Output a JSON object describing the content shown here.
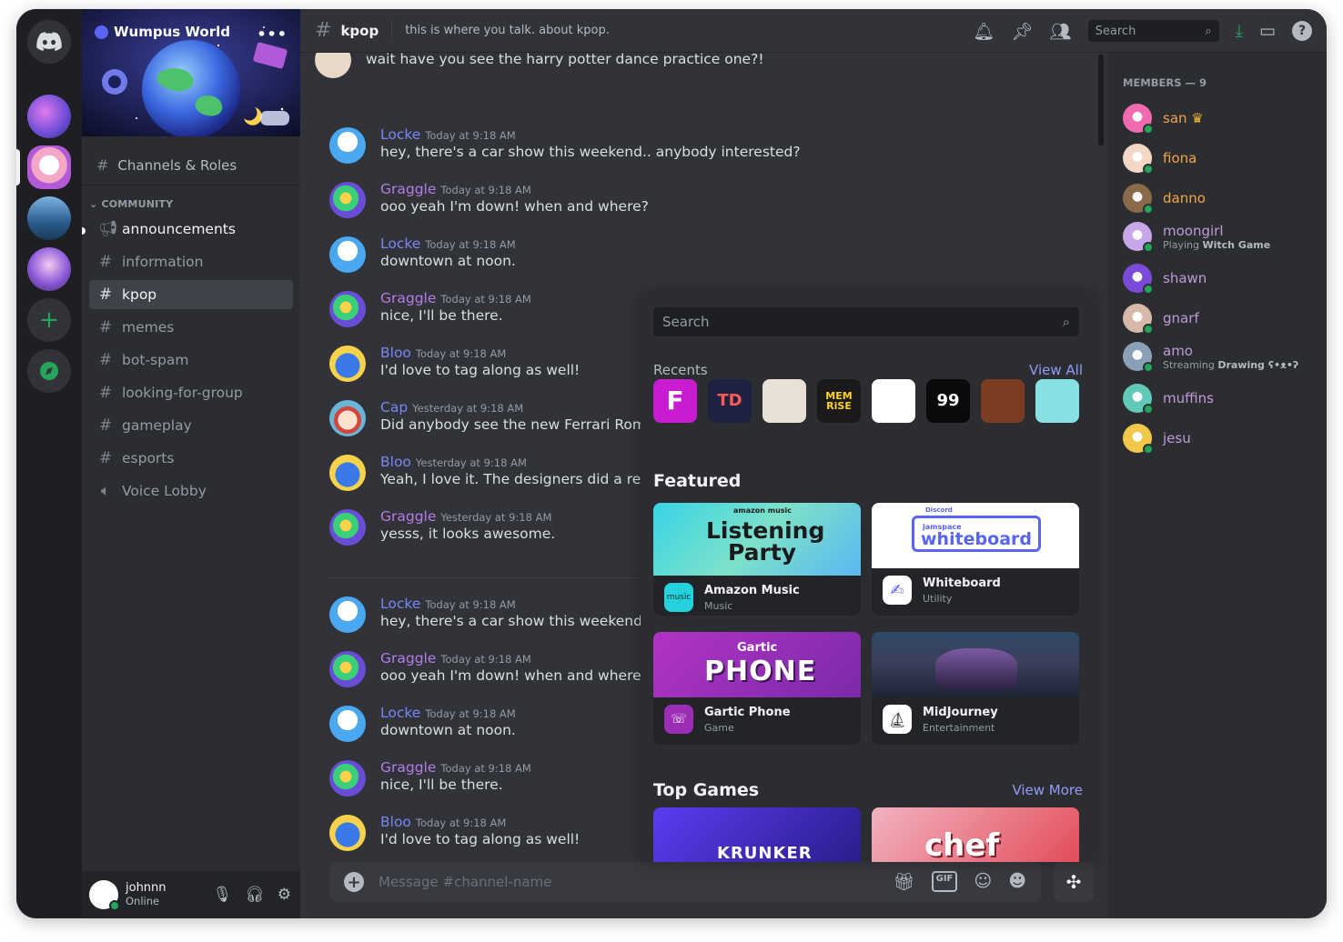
{
  "server": {
    "name": "Wumpus World",
    "roles_label": "Channels & Roles",
    "category": "COMMUNITY",
    "channels": [
      {
        "name": "announcements",
        "icon": "megaphone-icon"
      },
      {
        "name": "information",
        "icon": "hash-icon"
      },
      {
        "name": "kpop",
        "icon": "hash-icon"
      },
      {
        "name": "memes",
        "icon": "hash-icon"
      },
      {
        "name": "bot-spam",
        "icon": "hash-icon"
      },
      {
        "name": "looking-for-group",
        "icon": "hash-icon"
      },
      {
        "name": "gameplay",
        "icon": "hash-icon"
      },
      {
        "name": "esports",
        "icon": "hash-icon"
      },
      {
        "name": "Voice Lobby",
        "icon": "speaker-icon"
      }
    ]
  },
  "current_user": {
    "name": "johnnn",
    "status": "Online"
  },
  "header": {
    "channel": "kpop",
    "topic": "this is where you talk. about kpop.",
    "search_placeholder": "Search"
  },
  "messages": {
    "partial": "wait have you see the harry potter dance practice one?!",
    "list": [
      {
        "author": "Locke",
        "color": "#7b86f5",
        "time": "Today at 9:18 AM",
        "text": "hey, there's a car show this weekend.. anybody interested?"
      },
      {
        "author": "Graggle",
        "color": "#b37de8",
        "time": "Today at 9:18 AM",
        "text": "ooo yeah I'm down! when and where?"
      },
      {
        "author": "Locke",
        "color": "#7b86f5",
        "time": "Today at 9:18 AM",
        "text": "downtown at noon."
      },
      {
        "author": "Graggle",
        "color": "#b37de8",
        "time": "Today at 9:18 AM",
        "text": "nice, I'll be there."
      },
      {
        "author": "Bloo",
        "color": "#7b86f5",
        "time": "Today at 9:18 AM",
        "text": "I'd love to tag along as well!"
      },
      {
        "author": "Cap",
        "color": "#7b86f5",
        "time": "Yesterday at 9:18 AM",
        "text": "Did anybody see the new Ferrari Roma?"
      },
      {
        "author": "Bloo",
        "color": "#7b86f5",
        "time": "Yesterday at 9:18 AM",
        "text": "Yeah, I love it. The designers did a really g"
      },
      {
        "author": "Graggle",
        "color": "#b37de8",
        "time": "Yesterday at 9:18 AM",
        "text": "yesss, it looks awesome."
      },
      {
        "author": "Locke",
        "color": "#7b86f5",
        "time": "Today at 9:18 AM",
        "text": "hey, there's a car show this weekend.. any"
      },
      {
        "author": "Graggle",
        "color": "#b37de8",
        "time": "Today at 9:18 AM",
        "text": "ooo yeah I'm down! when and where?"
      },
      {
        "author": "Locke",
        "color": "#7b86f5",
        "time": "Today at 9:18 AM",
        "text": "downtown at noon."
      },
      {
        "author": "Graggle",
        "color": "#b37de8",
        "time": "Today at 9:18 AM",
        "text": "nice, I'll be there."
      },
      {
        "author": "Bloo",
        "color": "#7b86f5",
        "time": "Today at 9:18 AM",
        "text": "I'd love to tag along as well!"
      }
    ]
  },
  "composer": {
    "placeholder": "Message #channel-name"
  },
  "members": {
    "title": "MEMBERS — 9",
    "list": [
      {
        "name": "san",
        "color": "#f0a54a",
        "sub": "",
        "sub_bold": ""
      },
      {
        "name": "fiona",
        "color": "#f0a54a",
        "sub": "",
        "sub_bold": ""
      },
      {
        "name": "danno",
        "color": "#f0a54a",
        "sub": "",
        "sub_bold": ""
      },
      {
        "name": "moongirl",
        "color": "#c09bd9",
        "sub": "Playing ",
        "sub_bold": "Witch Game"
      },
      {
        "name": "shawn",
        "color": "#c09bd9",
        "sub": "",
        "sub_bold": ""
      },
      {
        "name": "gnarf",
        "color": "#c09bd9",
        "sub": "",
        "sub_bold": ""
      },
      {
        "name": "amo",
        "color": "#c09bd9",
        "sub": "Streaming ",
        "sub_bold": "Drawing ʕ•ᴥ•ʔ"
      },
      {
        "name": "muffins",
        "color": "#c09bd9",
        "sub": "",
        "sub_bold": ""
      },
      {
        "name": "jesu",
        "color": "#c09bd9",
        "sub": "",
        "sub_bold": ""
      }
    ]
  },
  "launcher": {
    "search_placeholder": "Search",
    "recents_label": "Recents",
    "view_all": "View All",
    "featured_label": "Featured",
    "top_games_label": "Top Games",
    "view_more": "View More",
    "featured": [
      {
        "title": "Amazon Music",
        "category": "Music",
        "art_top": "amazon music",
        "art_line1": "Listening",
        "art_line2": "Party",
        "icon_text": "music"
      },
      {
        "title": "Whiteboard",
        "category": "Utility",
        "art_top": "Discord",
        "art_line1": "jamspace",
        "art_line2": "whiteboard"
      },
      {
        "title": "Gartic Phone",
        "category": "Game",
        "art_line1": "Gartic",
        "art_line2": "PHONE"
      },
      {
        "title": "MidJourney",
        "category": "Entertainment"
      }
    ],
    "recents": [
      {
        "label": "F",
        "bg": "#c91bcf",
        "fg": "#ffffff"
      },
      {
        "label": "TD",
        "bg": "#1e2240",
        "fg": "#ff5a5a"
      },
      {
        "label": "",
        "bg": "#e9e1d5",
        "fg": "#555555"
      },
      {
        "label": "MEM RiSE",
        "bg": "#1a1a1a",
        "fg": "#ffd21f"
      },
      {
        "label": "",
        "bg": "#ffffff",
        "fg": "#222222"
      },
      {
        "label": "99",
        "bg": "#0a0a0a",
        "fg": "#ffffff"
      },
      {
        "label": "",
        "bg": "#7a3d22",
        "fg": "#ffc23a"
      },
      {
        "label": "",
        "bg": "#86e0e4",
        "fg": "#d9542f"
      }
    ],
    "games": [
      {
        "art_text": "KRUNKER"
      },
      {
        "art_text": "chef"
      }
    ]
  }
}
